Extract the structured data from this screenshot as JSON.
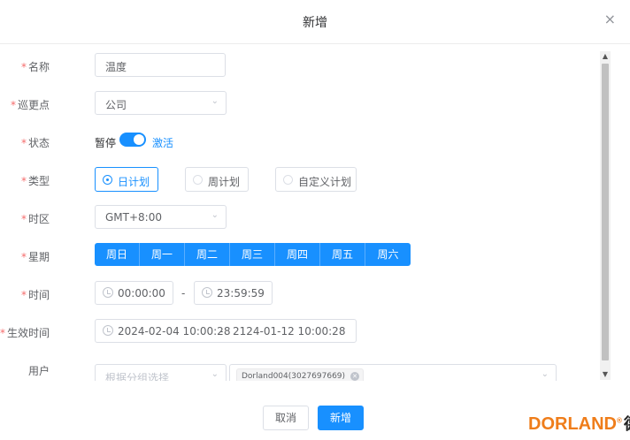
{
  "dialog": {
    "title": "新增",
    "close_icon": "×"
  },
  "form": {
    "name": {
      "label": "名称",
      "value": "温度"
    },
    "patrol_point": {
      "label": "巡更点",
      "value": "公司"
    },
    "status": {
      "label": "状态",
      "off_label": "暂停",
      "on_label": "激活",
      "enabled": true
    },
    "type": {
      "label": "类型",
      "options": [
        "日计划",
        "周计划",
        "自定义计划"
      ],
      "selected": "日计划"
    },
    "timezone": {
      "label": "时区",
      "value": "GMT+8:00"
    },
    "weekdays": {
      "label": "星期",
      "days": [
        "周日",
        "周一",
        "周二",
        "周三",
        "周四",
        "周五",
        "周六"
      ]
    },
    "time": {
      "label": "时间",
      "start": "00:00:00",
      "separator": "-",
      "end": "23:59:59"
    },
    "effective": {
      "label": "生效时间",
      "start": "2024-02-04 10:00:28",
      "separator": "-",
      "end": "2124-01-12 10:00:28"
    },
    "users": {
      "label": "用户",
      "group_placeholder": "根据分组选择",
      "tags": [
        "Dorland004(3027697669)"
      ]
    },
    "required_mark": "*"
  },
  "footer": {
    "cancel_label": "取消",
    "confirm_label": "新增"
  },
  "brand": {
    "name": "DORLAND",
    "reg": "®",
    "cn": "德兰"
  },
  "colors": {
    "primary": "#1890ff",
    "required": "#f56c6c",
    "brand": "#ef7d1a"
  }
}
